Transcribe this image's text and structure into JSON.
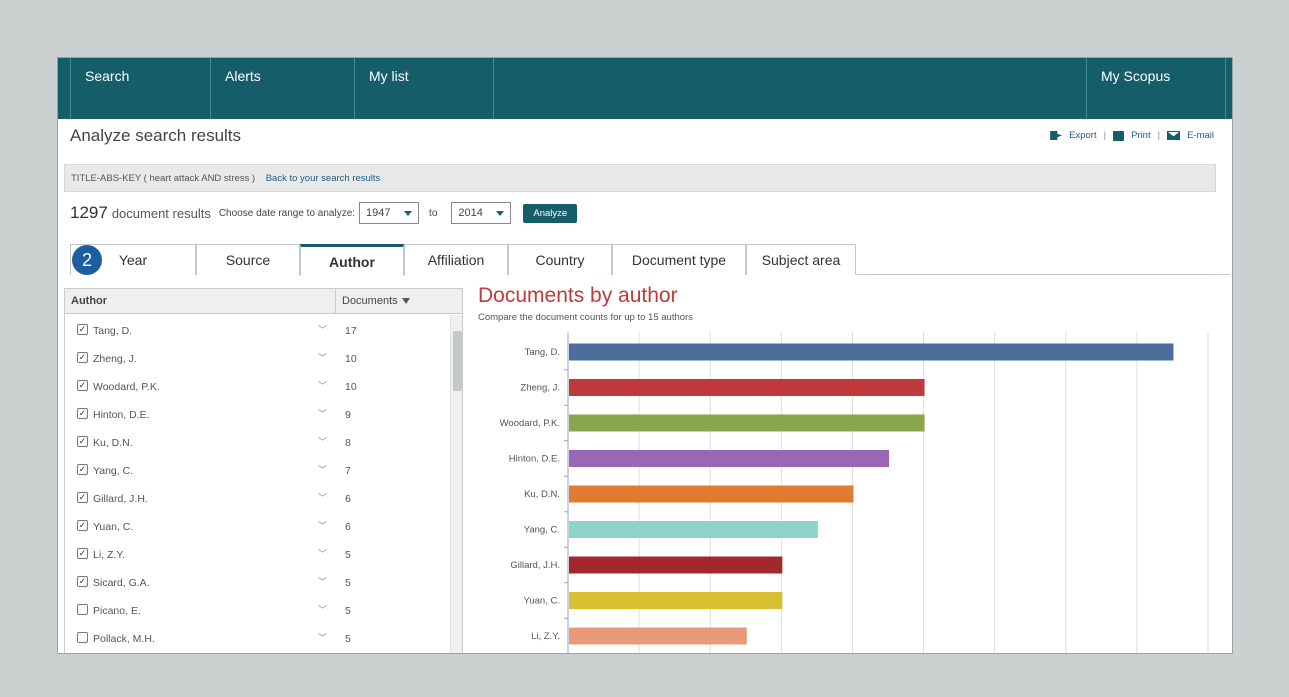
{
  "nav": {
    "items": [
      "Search",
      "Alerts",
      "My list"
    ],
    "right_item": "My Scopus"
  },
  "page": {
    "title": "Analyze search results"
  },
  "actions": {
    "export": "Export",
    "print": "Print",
    "email": "E-mail"
  },
  "query": {
    "text": "TITLE-ABS-KEY ( heart attack AND stress )",
    "back_link": "Back to your search results"
  },
  "results": {
    "count": "1297",
    "label": "document results",
    "date_prompt": "Choose date range to analyze:",
    "from_year": "1947",
    "to_label": "to",
    "to_year": "2014",
    "analyze_label": "Analyze"
  },
  "step_badge": "2",
  "tabs": [
    {
      "label": "Year",
      "active": false
    },
    {
      "label": "Source",
      "active": false
    },
    {
      "label": "Author",
      "active": true
    },
    {
      "label": "Affiliation",
      "active": false
    },
    {
      "label": "Country",
      "active": false
    },
    {
      "label": "Document type",
      "active": false
    },
    {
      "label": "Subject area",
      "active": false
    }
  ],
  "table": {
    "col_author": "Author",
    "col_documents": "Documents",
    "rows": [
      {
        "name": "Tang, D.",
        "count": "17",
        "checked": true
      },
      {
        "name": "Zheng, J.",
        "count": "10",
        "checked": true
      },
      {
        "name": "Woodard, P.K.",
        "count": "10",
        "checked": true
      },
      {
        "name": "Hinton, D.E.",
        "count": "9",
        "checked": true
      },
      {
        "name": "Ku, D.N.",
        "count": "8",
        "checked": true
      },
      {
        "name": "Yang, C.",
        "count": "7",
        "checked": true
      },
      {
        "name": "Gillard, J.H.",
        "count": "6",
        "checked": true
      },
      {
        "name": "Yuan, C.",
        "count": "6",
        "checked": true
      },
      {
        "name": "Li, Z.Y.",
        "count": "5",
        "checked": true
      },
      {
        "name": "Sicard, G.A.",
        "count": "5",
        "checked": true
      },
      {
        "name": "Picano, E.",
        "count": "5",
        "checked": false
      },
      {
        "name": "Pollack, M.H.",
        "count": "5",
        "checked": false
      }
    ]
  },
  "chart_data": {
    "type": "bar",
    "orientation": "horizontal",
    "title": "Documents by author",
    "subtitle": "Compare the document counts for up to 15 authors",
    "categories": [
      "Tang, D.",
      "Zheng, J.",
      "Woodard, P.K.",
      "Hinton, D.E.",
      "Ku, D.N.",
      "Yang, C.",
      "Gillard, J.H.",
      "Yuan, C.",
      "Li, Z.Y."
    ],
    "values": [
      17,
      10,
      10,
      9,
      8,
      7,
      6,
      6,
      5
    ],
    "colors": [
      "#4a6e9a",
      "#c0393b",
      "#8aa64a",
      "#9b66b3",
      "#e17b30",
      "#8ed3c9",
      "#a3282c",
      "#d9bf32",
      "#e89a78"
    ],
    "xlim": [
      0,
      18
    ],
    "grid": true,
    "legend": "none"
  }
}
